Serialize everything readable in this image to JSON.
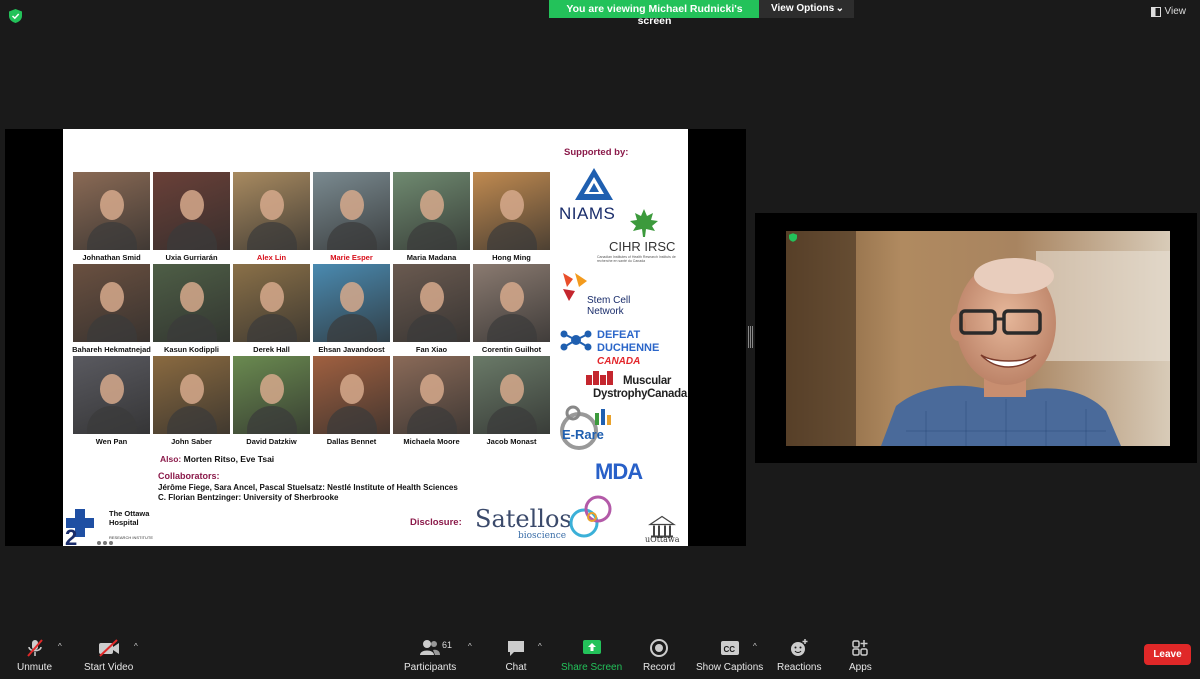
{
  "banner": {
    "viewing_text": "You are viewing Michael Rudnicki's screen",
    "view_options": "View Options"
  },
  "view_button": "View",
  "slide": {
    "supported_by": "Supported by:",
    "people": [
      [
        {
          "name": "Johnathan Smid",
          "highlight": false,
          "color": "#8a6a55"
        },
        {
          "name": "Uxia Gurriarán",
          "highlight": false,
          "color": "#6a4038"
        },
        {
          "name": "Alex Lin",
          "highlight": true,
          "color": "#a88a60"
        },
        {
          "name": "Marie Esper",
          "highlight": true,
          "color": "#7a8a90"
        },
        {
          "name": "Maria Madana",
          "highlight": false,
          "color": "#6f8a70"
        },
        {
          "name": "Hong Ming",
          "highlight": false,
          "color": "#c08a50"
        }
      ],
      [
        {
          "name": "Bahareh Hekmatnejad",
          "highlight": false,
          "color": "#6a5040"
        },
        {
          "name": "Kasun Kodippli",
          "highlight": false,
          "color": "#4e5e46"
        },
        {
          "name": "Derek Hall",
          "highlight": false,
          "color": "#8a7048"
        },
        {
          "name": "Ehsan Javandoost",
          "highlight": false,
          "color": "#4a8ab0"
        },
        {
          "name": "Fan Xiao",
          "highlight": false,
          "color": "#6a5a50"
        },
        {
          "name": "Corentin Guilhot",
          "highlight": false,
          "color": "#8a7a70"
        }
      ],
      [
        {
          "name": "Wen Pan",
          "highlight": false,
          "color": "#5a5a60"
        },
        {
          "name": "John Saber",
          "highlight": false,
          "color": "#8a6a40"
        },
        {
          "name": "David Datzkiw",
          "highlight": false,
          "color": "#6a8a50"
        },
        {
          "name": "Dallas Bennet",
          "highlight": false,
          "color": "#a06040"
        },
        {
          "name": "Michaela Moore",
          "highlight": false,
          "color": "#8a6a58"
        },
        {
          "name": "Jacob Monast",
          "highlight": false,
          "color": "#6a7a68"
        }
      ]
    ],
    "also_label": "Also:",
    "also_names": "Morten Ritso, Eve Tsai",
    "collaborators_label": "Collaborators:",
    "collaborators_line1": "Jérôme Fiege, Sara Ancel, Pascal Stuelsatz: Nestlé Institute of Health Sciences",
    "collaborators_line2": "C. Florian Bentzinger: University of Sherbrooke",
    "disclosure_label": "Disclosure:",
    "ohri_name_line1": "The Ottawa",
    "ohri_name_line2": "Hospital",
    "ohri_sub": "RESEARCH INSTITUTE",
    "satellos": "Satellos",
    "satellos_sub": "bioscience",
    "uottawa": "uOttawa",
    "niams": "NIAMS",
    "cihr": "CIHR IRSC",
    "cihr_small": "Canadian Institutes of Health Research   Instituts de recherche en santé du Canada",
    "scn_line1": "Stem Cell",
    "scn_line2": "Network",
    "dd_line1": "DEFEAT DUCHENNE",
    "dd_line2": "CANADA",
    "md_line1": "Muscular",
    "md_line2": "DystrophyCanada",
    "erare": "E-Rare",
    "mda": "MDA"
  },
  "toolbar": {
    "unmute": "Unmute",
    "start_video": "Start Video",
    "participants": "Participants",
    "participants_count": "61",
    "chat": "Chat",
    "share_screen": "Share Screen",
    "record": "Record",
    "show_captions": "Show Captions",
    "reactions": "Reactions",
    "apps": "Apps",
    "leave": "Leave"
  },
  "colors": {
    "green": "#23c25a",
    "leave_red": "#e02828",
    "slide_accent": "#8b1a4a"
  }
}
